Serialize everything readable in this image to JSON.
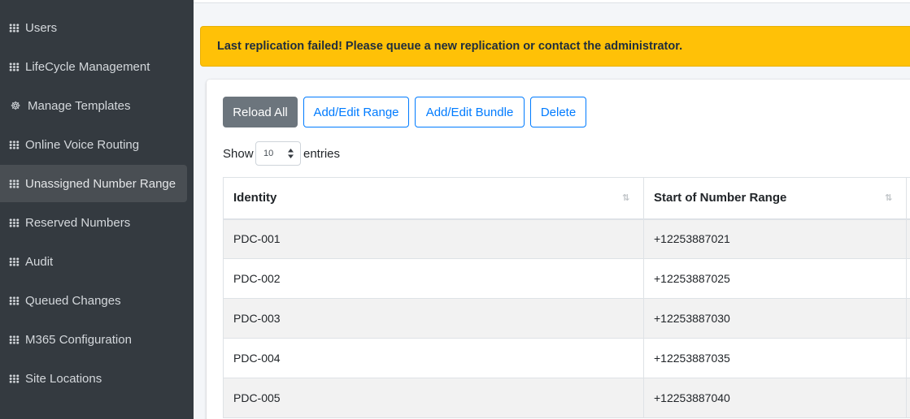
{
  "sidebar": {
    "items": [
      {
        "label": "Users",
        "icon": "grid-icon",
        "active": false
      },
      {
        "label": "LifeCycle Management",
        "icon": "grid-icon",
        "active": false
      },
      {
        "label": "Manage Templates",
        "icon": "template-icon",
        "active": false
      },
      {
        "label": "Online Voice Routing",
        "icon": "grid-icon",
        "active": false
      },
      {
        "label": "Unassigned Number Range",
        "icon": "grid-icon",
        "active": true
      },
      {
        "label": "Reserved Numbers",
        "icon": "grid-icon",
        "active": false
      },
      {
        "label": "Audit",
        "icon": "grid-icon",
        "active": false
      },
      {
        "label": "Queued Changes",
        "icon": "grid-icon",
        "active": false
      },
      {
        "label": "M365 Configuration",
        "icon": "grid-icon",
        "active": false
      },
      {
        "label": "Site Locations",
        "icon": "grid-icon",
        "active": false
      }
    ]
  },
  "alert": {
    "message": "Last replication failed! Please queue a new replication or contact the administrator."
  },
  "toolbar": {
    "reload_label": "Reload All",
    "add_range_label": "Add/Edit Range",
    "add_bundle_label": "Add/Edit Bundle",
    "delete_label": "Delete"
  },
  "length_menu": {
    "show_label": "Show",
    "selected": "10",
    "entries_label": "entries"
  },
  "table": {
    "columns": [
      "Identity",
      "Start of Number Range"
    ],
    "rows": [
      [
        "PDC-001",
        "+12253887021"
      ],
      [
        "PDC-002",
        "+12253887025"
      ],
      [
        "PDC-003",
        "+12253887030"
      ],
      [
        "PDC-004",
        "+12253887035"
      ],
      [
        "PDC-005",
        "+12253887040"
      ]
    ]
  },
  "colors": {
    "sidebar_bg": "#343a40",
    "alert_bg": "#ffc107",
    "primary": "#007bff",
    "secondary": "#6c757d"
  }
}
